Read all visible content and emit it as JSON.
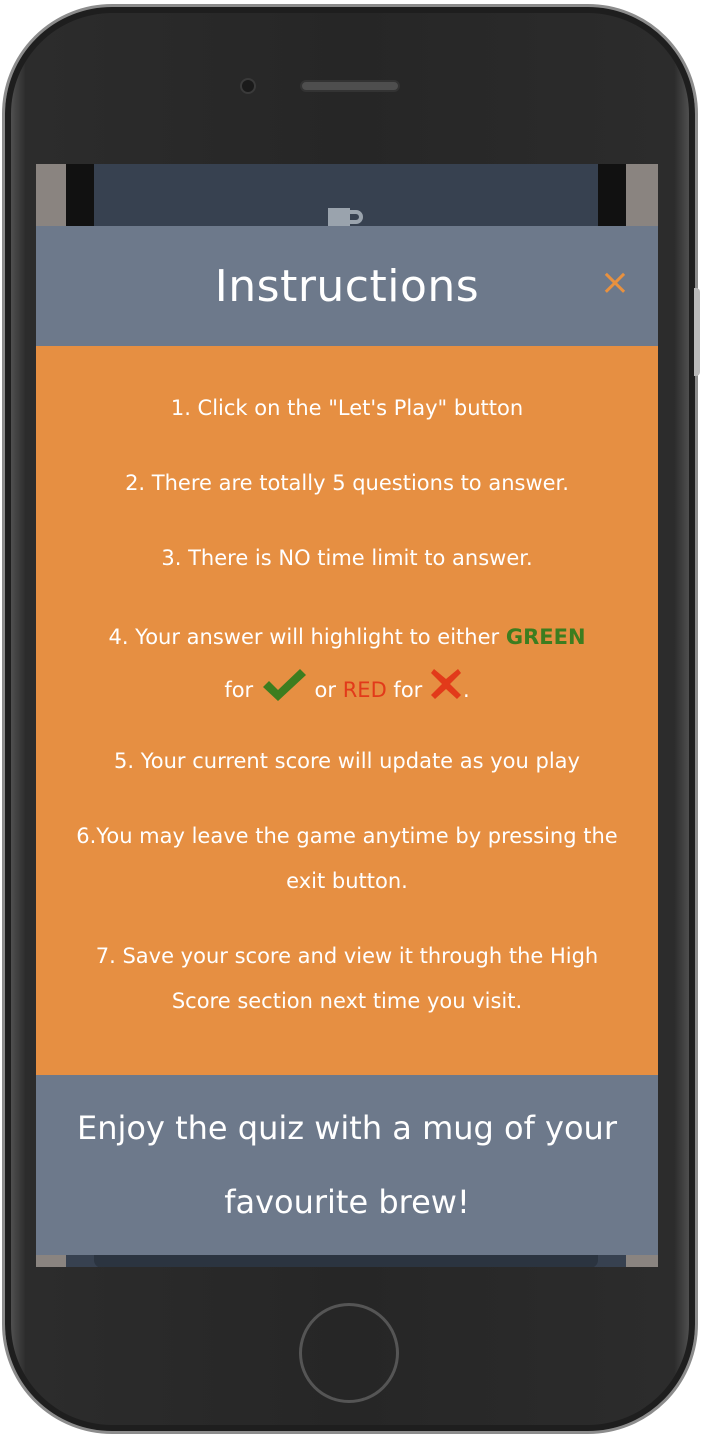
{
  "modal": {
    "title": "Instructions",
    "close_symbol": "×",
    "instructions": {
      "i1": "1. Click on the \"Let's Play\" button",
      "i2": "2. There are totally 5 questions to answer.",
      "i3": "3. There is NO time limit to answer.",
      "i4_prefix": "4. Your answer will highlight to either ",
      "i4_green": "GREEN",
      "i4_for1": " for ",
      "i4_or": " or ",
      "i4_red": "RED",
      "i4_for2": " for ",
      "i4_end": ".",
      "i5": "5. Your current score will update as you play",
      "i6": "6.You may leave the game anytime by pressing the exit button.",
      "i7": "7. Save your score and view it through the High Score section next time you visit."
    },
    "footer": "Enjoy the quiz with a mug of your favourite brew!"
  },
  "colors": {
    "header_bg": "#6d798b",
    "body_bg": "#e68f42",
    "green": "#3d7d1f",
    "red": "#e23a1a",
    "close": "#e8913f"
  },
  "icons": {
    "correct": "check-icon",
    "wrong": "cross-icon",
    "close": "close-icon"
  }
}
